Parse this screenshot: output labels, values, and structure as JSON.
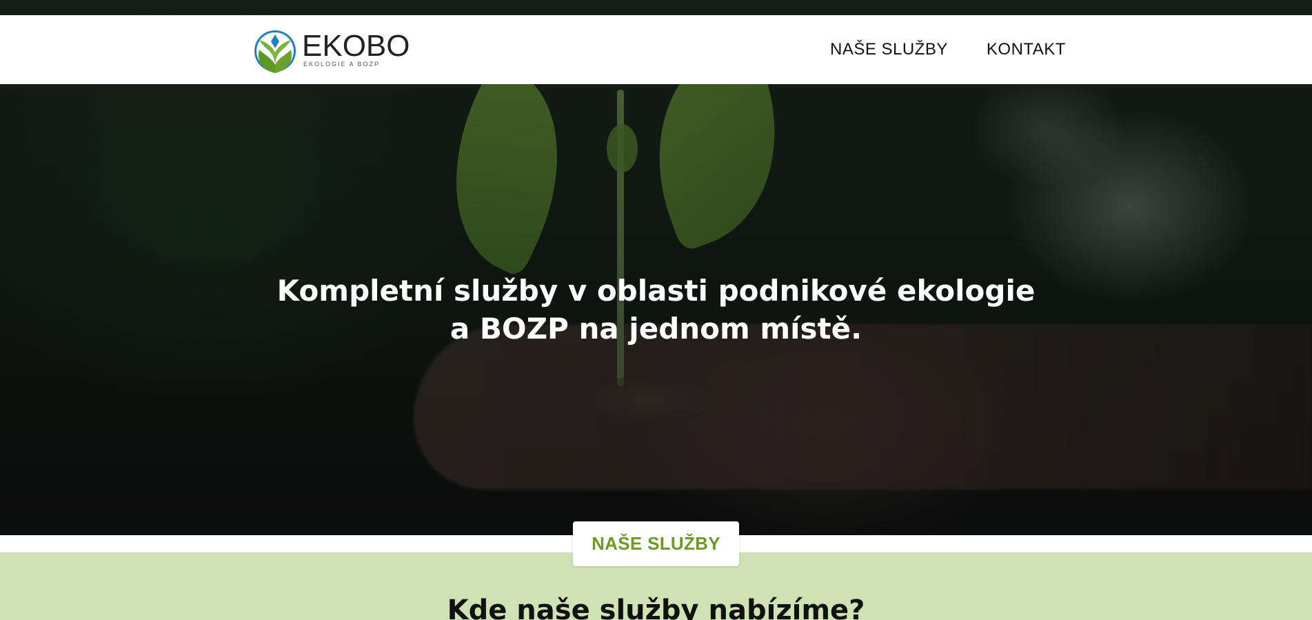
{
  "header": {
    "logo": {
      "name": "EKOBO",
      "subtitle": "EKOLOGIE A BOZP"
    },
    "nav": [
      {
        "label": "NAŠE SLUŽBY"
      },
      {
        "label": "KONTAKT"
      }
    ]
  },
  "hero": {
    "title_line1": "Kompletní služby v oblasti podnikové ekologie",
    "title_line2": "a BOZP na jednom místě.",
    "cta_label": "NAŠE SLUŽBY"
  },
  "section": {
    "title": "Kde naše služby nabízíme?"
  },
  "colors": {
    "accent_green": "#6b9a25",
    "section_bg": "#cfe2b3",
    "logo_blue": "#1f7fc4",
    "logo_green": "#6aa32c"
  },
  "icons": {
    "logo_mark": "leaf-drop-logo-icon"
  }
}
